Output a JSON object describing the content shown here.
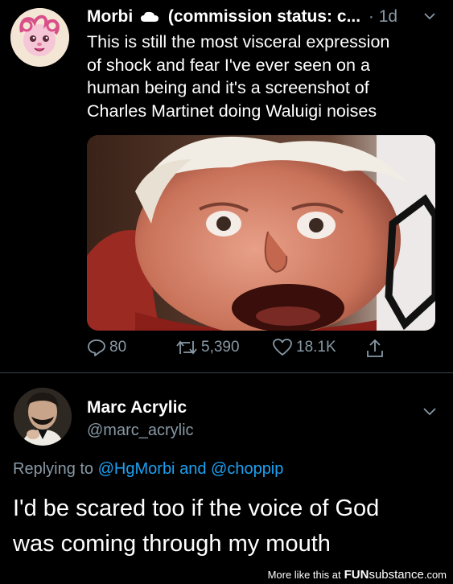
{
  "tweet": {
    "author_name": "Morbi",
    "author_status": "(commission status: c...",
    "timestamp": "· 1d",
    "body_lines": [
      "This is still the most visceral expression",
      "of shock and fear I've ever seen on a",
      "human being and it's a screenshot of",
      "Charles Martinet doing Waluigi noises"
    ],
    "photo_icon": "shocked-face-photo",
    "actions": {
      "reply_count": "80",
      "retweet_count": "5,390",
      "like_count": "18.1K"
    }
  },
  "reply": {
    "author_name": "Marc Acrylic",
    "author_handle": "@marc_acrylic",
    "replying_prefix": "Replying to",
    "replying_mention_1": "@HgMorbi",
    "replying_and": "and",
    "replying_mention_2": "@choppip",
    "body_lines": [
      "I'd be scared too if the voice of God",
      "was coming through my mouth"
    ]
  },
  "footer": {
    "text": "More like this at",
    "brand_fun": "FUN",
    "brand_substance": "substance",
    "brand_com": ".com"
  },
  "colors": {
    "background": "#000000",
    "secondary_text": "#8899a6",
    "mention": "#1da1f2",
    "divider": "#38444d"
  }
}
